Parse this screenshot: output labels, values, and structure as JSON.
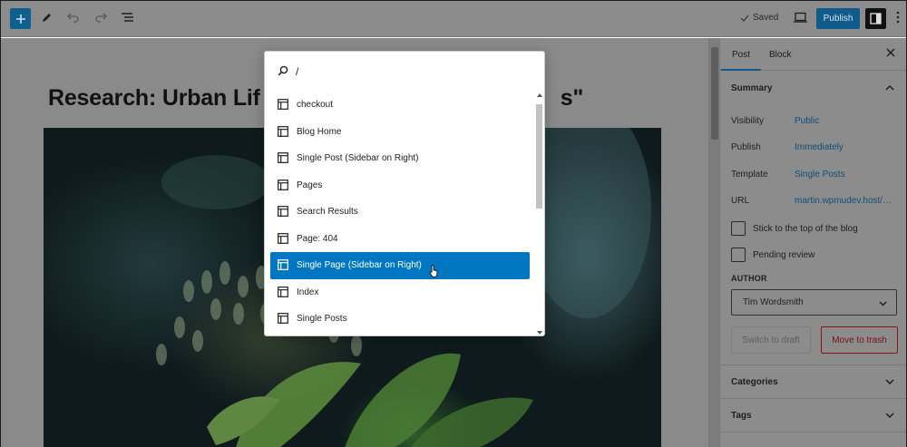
{
  "toolbar": {
    "saved_label": "Saved",
    "publish_label": "Publish"
  },
  "editor": {
    "title_left": "Research: Urban Lif",
    "title_right": "s\""
  },
  "sidebar": {
    "tabs": [
      "Post",
      "Block"
    ],
    "summary_label": "Summary",
    "rows": [
      {
        "label": "Visibility",
        "value": "Public"
      },
      {
        "label": "Publish",
        "value": "Immediately"
      },
      {
        "label": "Template",
        "value": "Single Posts"
      },
      {
        "label": "URL",
        "value": "martin.wpmudev.host/…"
      }
    ],
    "sticky_label": "Stick to the top of the blog",
    "pending_label": "Pending review",
    "author_label": "AUTHOR",
    "author_value": "Tim Wordsmith",
    "draft_label": "Switch to draft",
    "trash_label": "Move to trash",
    "panels": [
      "Categories",
      "Tags"
    ]
  },
  "palette": {
    "query": "/",
    "items": [
      {
        "label": "checkout"
      },
      {
        "label": "Blog Home"
      },
      {
        "label": "Single Post (Sidebar on Right)"
      },
      {
        "label": "Pages"
      },
      {
        "label": "Search Results"
      },
      {
        "label": "Page: 404"
      },
      {
        "label": "Single Page (Sidebar on Right)",
        "active": true
      },
      {
        "label": "Index"
      },
      {
        "label": "Single Posts"
      }
    ]
  },
  "colors": {
    "accent": "#0077c0",
    "publish_bg": "#0f5c8c",
    "trash": "#8c1414"
  }
}
